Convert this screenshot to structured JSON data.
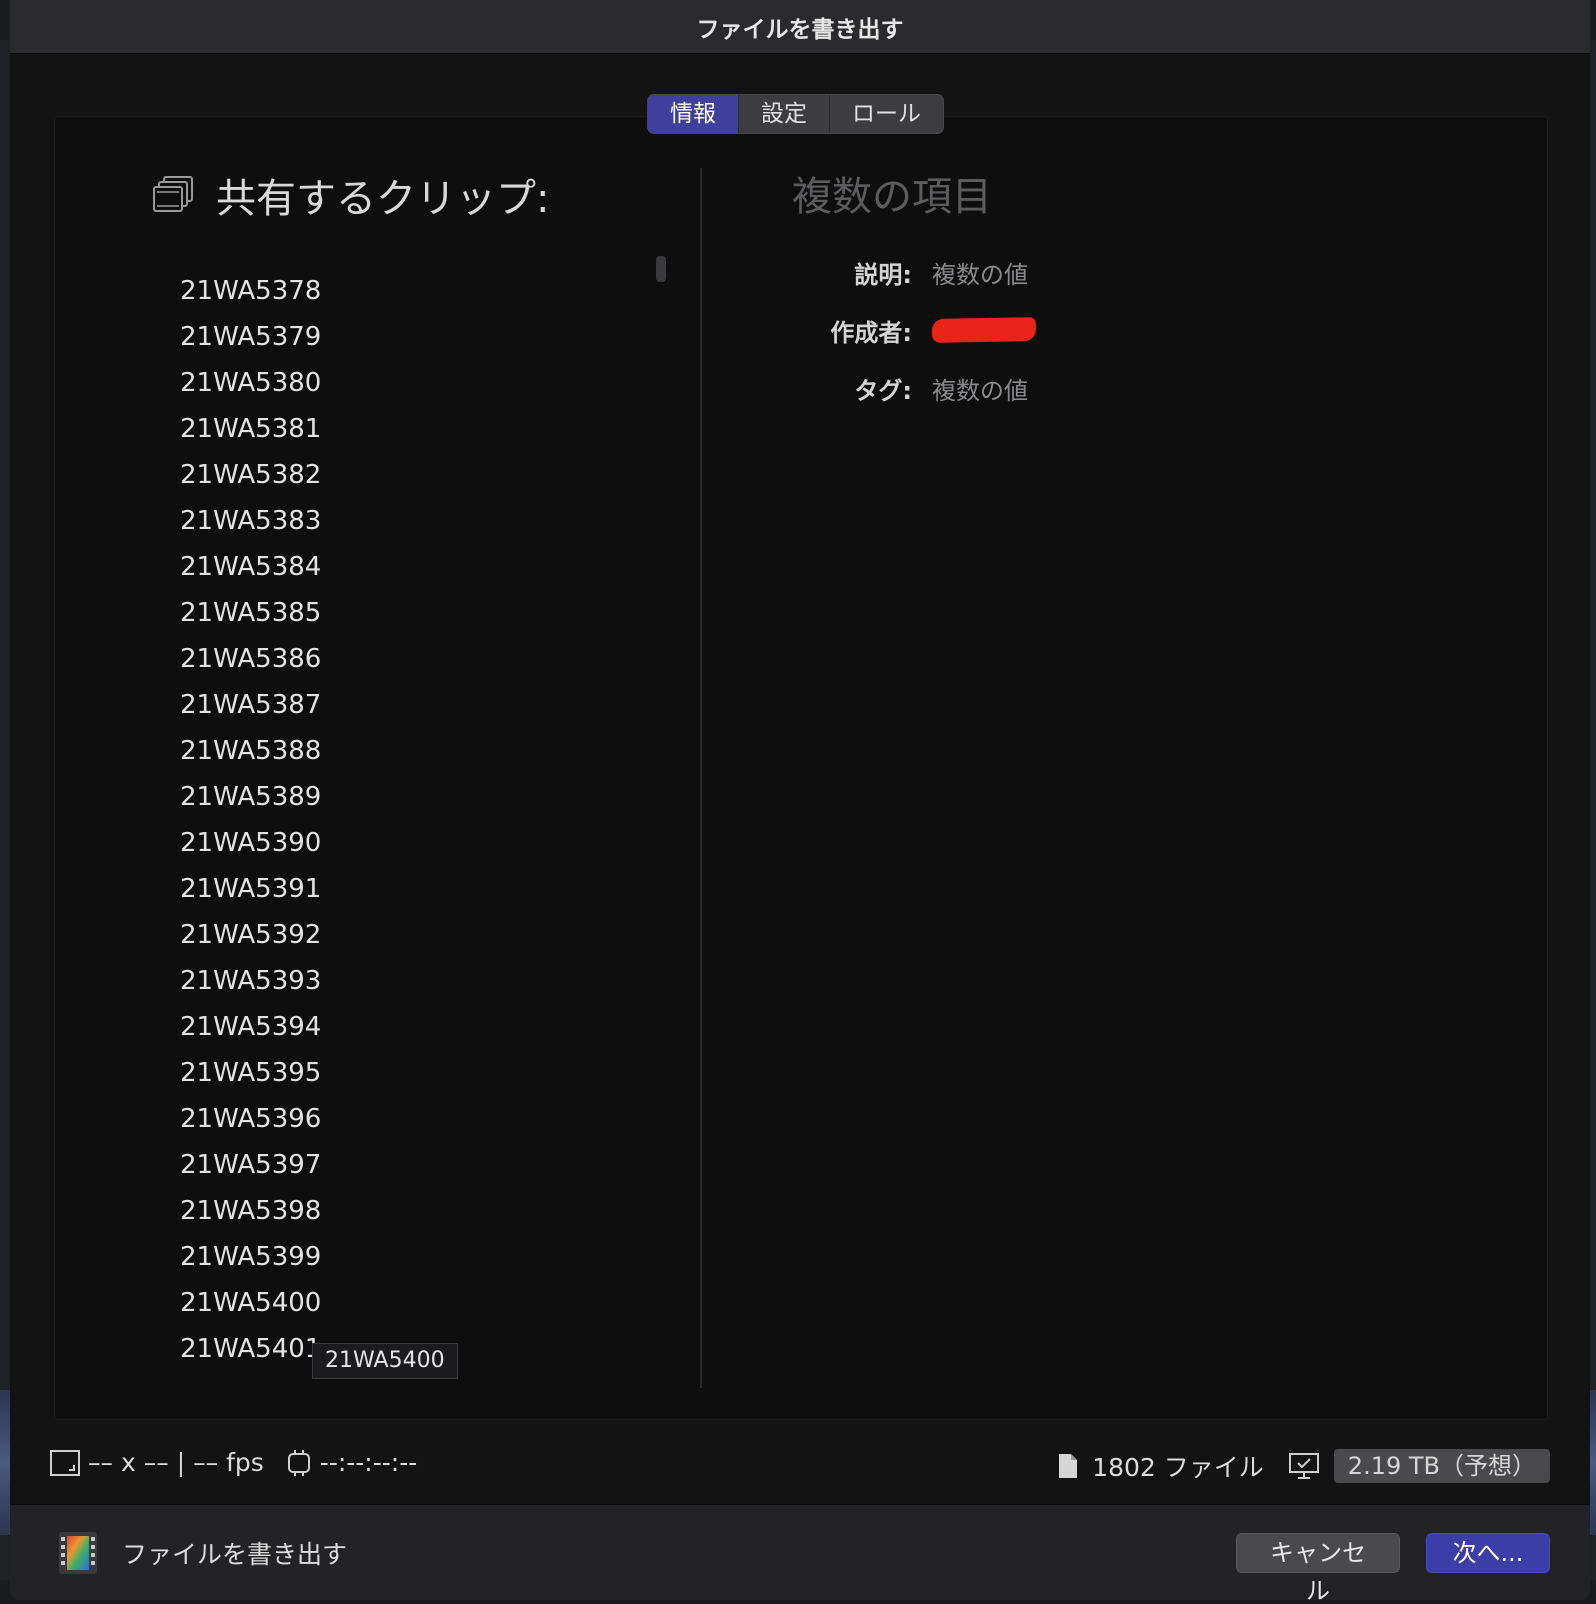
{
  "window": {
    "title": "ファイルを書き出す"
  },
  "tabs": [
    {
      "label": "情報",
      "active": true
    },
    {
      "label": "設定",
      "active": false
    },
    {
      "label": "ロール",
      "active": false
    }
  ],
  "clips": {
    "heading": "共有するクリップ:",
    "items": [
      "21WA5378",
      "21WA5379",
      "21WA5380",
      "21WA5381",
      "21WA5382",
      "21WA5383",
      "21WA5384",
      "21WA5385",
      "21WA5386",
      "21WA5387",
      "21WA5388",
      "21WA5389",
      "21WA5390",
      "21WA5391",
      "21WA5392",
      "21WA5393",
      "21WA5394",
      "21WA5395",
      "21WA5396",
      "21WA5397",
      "21WA5398",
      "21WA5399",
      "21WA5400",
      "21WA5401"
    ],
    "tooltip": "21WA5400"
  },
  "info": {
    "title": "複数の項目",
    "description": {
      "label": "説明:",
      "value": "複数の値"
    },
    "creator": {
      "label": "作成者:"
    },
    "tags": {
      "label": "タグ:",
      "value": "複数の値"
    }
  },
  "status": {
    "resolution": "–– x ––",
    "fps": "–– fps",
    "timecode": "--:--:--:--",
    "file_count": "1802 ファイル",
    "size_estimate": "2.19 TB（予想）"
  },
  "footer": {
    "label": "ファイルを書き出す",
    "cancel": "キャンセル",
    "next": "次へ..."
  },
  "colors": {
    "accent": "#3f3f9e",
    "redaction": "#e8231a"
  }
}
